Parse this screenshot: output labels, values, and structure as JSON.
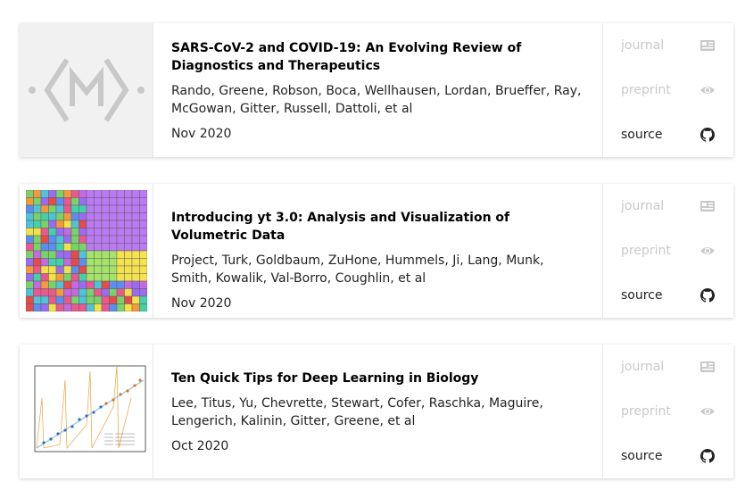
{
  "papers": [
    {
      "title": "SARS-CoV-2 and COVID-19: An Evolving Review of Diagnostics and Therapeutics",
      "authors": "Rando, Greene, Robson, Boca, Wellhausen, Lordan, Brueffer, Ray, McGowan, Gitter, Russell, Dattoli, et al",
      "date": "Nov 2020",
      "thumb": "manubot-logo",
      "links": {
        "journal": "journal",
        "preprint": "preprint",
        "source": "source"
      }
    },
    {
      "title": "Introducing yt 3.0: Analysis and Visualization of Volumetric Data",
      "authors": "Project, Turk, Goldbaum, ZuHone, Hummels, Ji, Lang, Munk, Smith, Kowalik, Val-Borro, Coughlin, et al",
      "date": "Nov 2020",
      "thumb": "color-grid",
      "links": {
        "journal": "journal",
        "preprint": "preprint",
        "source": "source"
      }
    },
    {
      "title": "Ten Quick Tips for Deep Learning in Biology",
      "authors": "Lee, Titus, Yu, Chevrette, Stewart, Cofer, Raschka, Maguire, Lengerich, Kalinin, Gitter, Greene, et al",
      "date": "Oct 2020",
      "thumb": "scatter-plot",
      "links": {
        "journal": "journal",
        "preprint": "preprint",
        "source": "source"
      }
    }
  ],
  "colors": {
    "dim": "#c9c9c9",
    "text": "#222222"
  }
}
